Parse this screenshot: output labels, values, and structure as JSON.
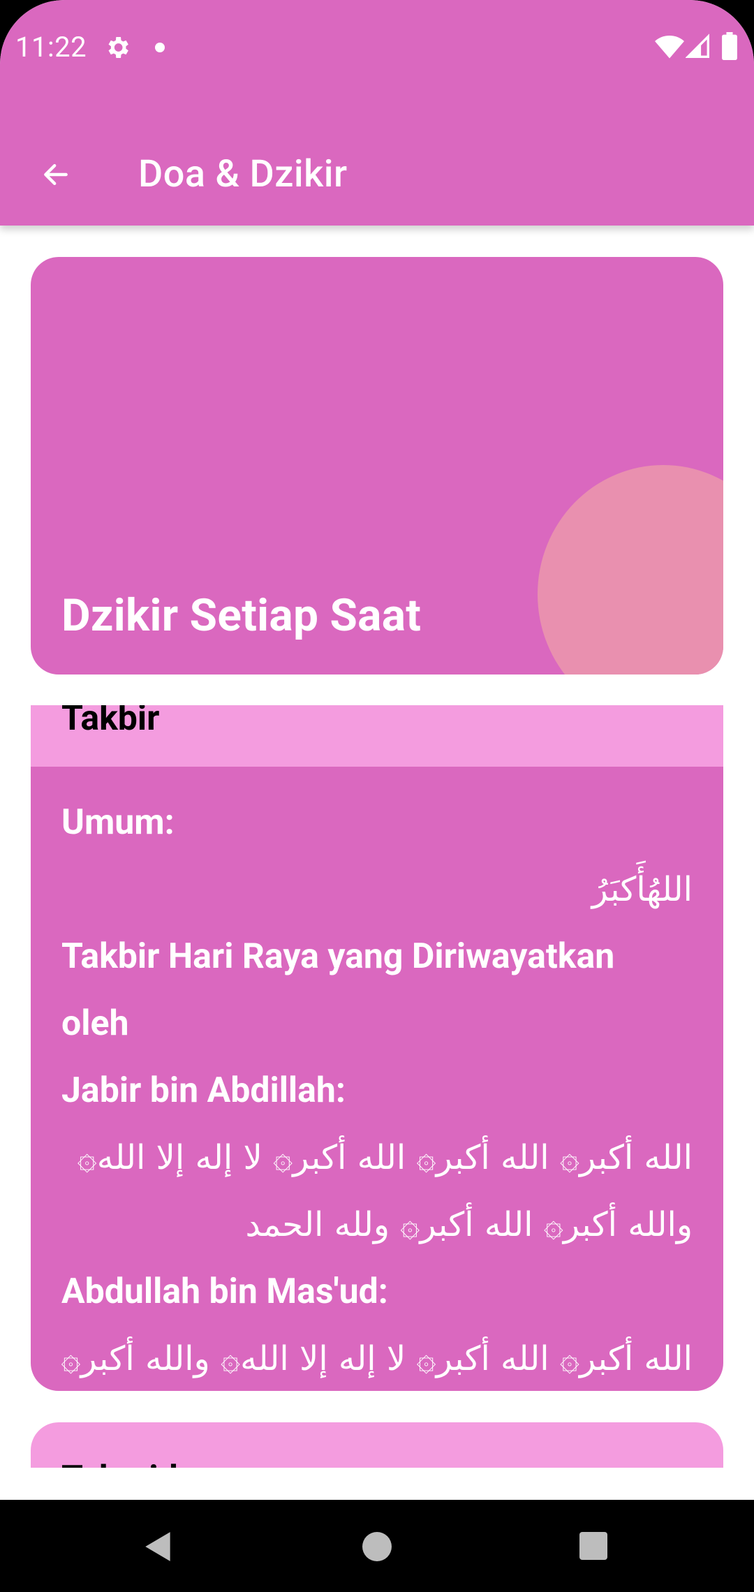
{
  "status_bar": {
    "time": "11:22",
    "icons": [
      "gear-icon",
      "notification-dot-icon",
      "wifi-icon",
      "signal-icon",
      "battery-icon"
    ]
  },
  "app_bar": {
    "title": "Doa & Dzikir",
    "back_icon": "arrow-left-icon"
  },
  "header_card": {
    "title": "Dzikir Setiap Saat"
  },
  "content_card": {
    "section_title": "Takbir",
    "lines": [
      {
        "kind": "label",
        "text": "Umum:"
      },
      {
        "kind": "arabic",
        "text": "اللهُأَكبَرُ"
      },
      {
        "kind": "label",
        "text": "Takbir Hari Raya yang Diriwayatkan"
      },
      {
        "kind": "label",
        "text": "oleh"
      },
      {
        "kind": "label",
        "text": "Jabir bin Abdillah:"
      },
      {
        "kind": "arabic",
        "text": "الله أكبر۞ الله أكبر۞ الله أكبر۞ لا إله إلا الله۞"
      },
      {
        "kind": "arabic",
        "text": "والله أكبر۞ الله أكبر۞ ولله الحمد"
      },
      {
        "kind": "label",
        "text": "Abdullah bin Mas'ud:"
      },
      {
        "kind": "arabic",
        "text": "الله أكبر۞ الله أكبر۞ لا إله إلا الله۞ والله أكبر۞"
      }
    ]
  },
  "next_card": {
    "title": "Tahmid"
  },
  "nav_bar": {
    "icons": [
      "nav-back-icon",
      "nav-home-icon",
      "nav-recents-icon"
    ]
  },
  "colors": {
    "primary": "#DA68BF",
    "section_header": "#F49CDF",
    "decor_circle": "#E990AF"
  }
}
